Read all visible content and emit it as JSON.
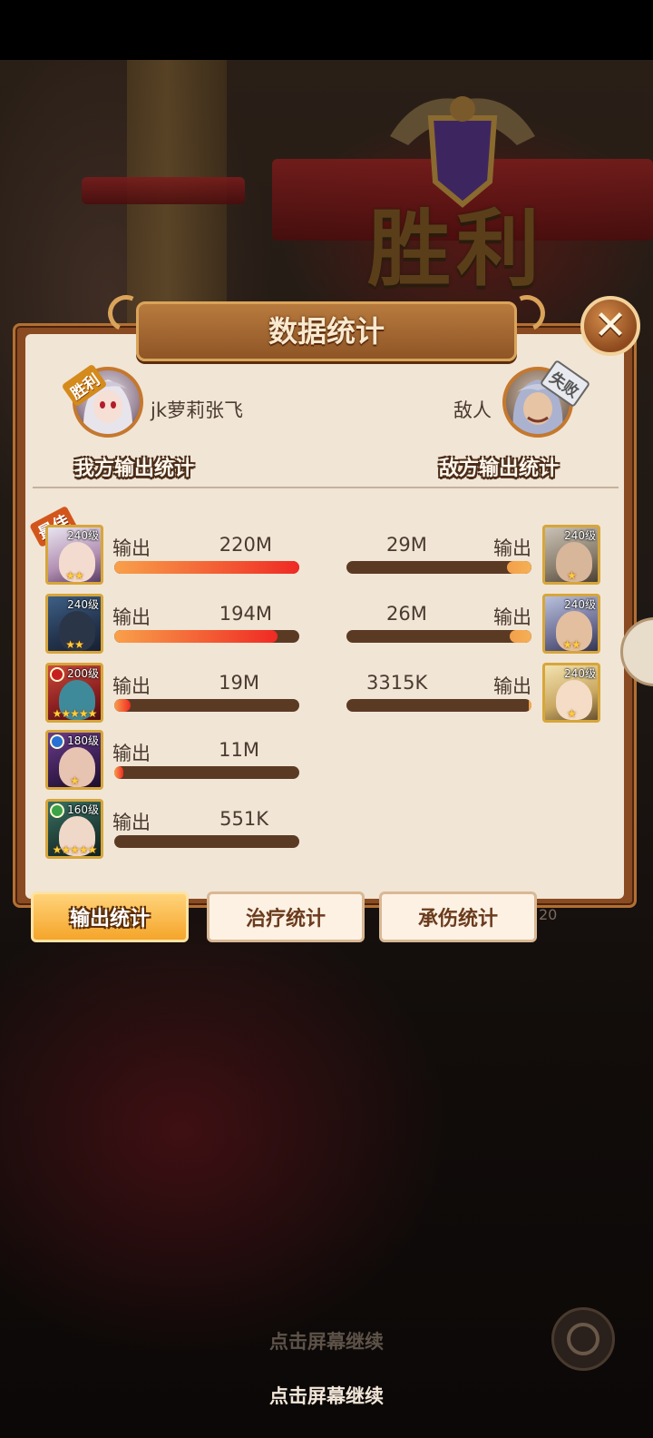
{
  "scene": {
    "victory_text": "胜利",
    "continue_hint": "点击屏幕继续",
    "round_number": "20"
  },
  "panel": {
    "title": "数据统计",
    "close_glyph": "✕"
  },
  "players": {
    "ally": {
      "name": "jk萝莉张飞",
      "result_tag": "胜利",
      "section_title": "我方输出统计"
    },
    "enemy": {
      "name": "敌人",
      "result_tag": "失败",
      "section_title": "敌方输出统计"
    }
  },
  "stats": {
    "metric_label": "输出",
    "best_tag": "最佳",
    "ally_heroes": [
      {
        "level": "240级",
        "value": "220M",
        "ratio": 1.0,
        "stars": "★★",
        "element": "fire"
      },
      {
        "level": "240级",
        "value": "194M",
        "ratio": 0.88,
        "stars": "★★",
        "element": "light"
      },
      {
        "level": "200级",
        "value": "19M",
        "ratio": 0.09,
        "stars": "★★★★★",
        "element": "fire"
      },
      {
        "level": "180级",
        "value": "11M",
        "ratio": 0.05,
        "stars": "★",
        "element": "water"
      },
      {
        "level": "160级",
        "value": "551K",
        "ratio": 0.0,
        "stars": "★★★★★",
        "element": "wind"
      }
    ],
    "enemy_heroes": [
      {
        "level": "240级",
        "value": "29M",
        "ratio": 0.13,
        "stars": "★",
        "element": "light"
      },
      {
        "level": "240级",
        "value": "26M",
        "ratio": 0.12,
        "stars": "★★",
        "element": "light"
      },
      {
        "level": "240级",
        "value": "3315K",
        "ratio": 0.015,
        "stars": "★",
        "element": "light"
      }
    ]
  },
  "tabs": [
    {
      "label": "输出统计",
      "active": true
    },
    {
      "label": "治疗统计",
      "active": false
    },
    {
      "label": "承伤统计",
      "active": false
    }
  ],
  "colors": {
    "panel_bg": "#f1e5d5",
    "ally_bar_fill": "#ef2a24",
    "enemy_bar_fill": "#f5b056",
    "bar_track": "#5b3a24"
  }
}
